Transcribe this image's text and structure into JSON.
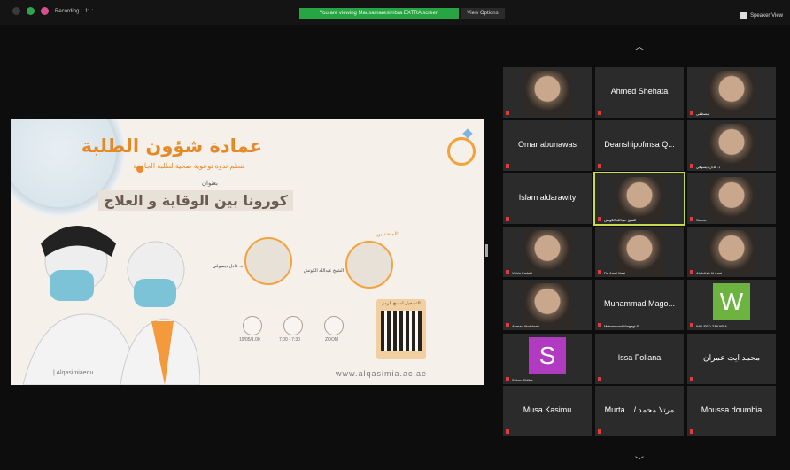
{
  "topbar": {
    "meeting_title": "Recording... 11 :",
    "share_banner": "You are viewing Mausamaresimbra EXTRA screen",
    "view_options": "View Options",
    "speaker_view": "Speaker View"
  },
  "slide": {
    "title_ar": "عمادة شؤون الطلبة",
    "subtitle_ar": "تنظم ندوة توعوية صحية لطلبة الجامعة",
    "by_title_ar": "بعنوان",
    "topic_ar": "كورونا بين الوقاية و العلاج",
    "speakers_label_ar": "المتحدثين:",
    "speaker1_name_ar": "د. عادل ديسوقي",
    "speaker2_name_ar": "الشيخ عبدالله الكوتش",
    "icon_label_1": "19/05/1.00",
    "icon_label_2": "7:00 - 7:30",
    "icon_label_3": "ZOOM",
    "qr_label": "للتسجيل امسح الرمز",
    "footer_left": "| Alqasimiaedu",
    "footer_right": "www.alqasimia.ac.ae"
  },
  "participants": [
    {
      "name": "",
      "tag": "",
      "kind": "video"
    },
    {
      "name": "Ahmed Shehata",
      "tag": "",
      "kind": "text"
    },
    {
      "name": "",
      "tag": "مصطفى",
      "kind": "video"
    },
    {
      "name": "Omar abunawas",
      "tag": "",
      "kind": "text"
    },
    {
      "name": "Deanshipofmsa Q...",
      "tag": "",
      "kind": "text"
    },
    {
      "name": "",
      "tag": "د. عادل ديسوقي",
      "kind": "video"
    },
    {
      "name": "Islam aldarawity",
      "tag": "",
      "kind": "text"
    },
    {
      "name": "",
      "tag": "الشيخ عبدالله الكوتش",
      "kind": "video"
    },
    {
      "name": "",
      "tag": "Salma",
      "kind": "video"
    },
    {
      "name": "",
      "tag": "Yahia Sadeki",
      "kind": "video"
    },
    {
      "name": "",
      "tag": "Dr. Amel Nezi",
      "kind": "video"
    },
    {
      "name": "",
      "tag": "Abdullah Al Amri",
      "kind": "video"
    },
    {
      "name": "",
      "tag": "Ahmad Abdelaziz",
      "kind": "video"
    },
    {
      "name": "Muhammad Mago...",
      "tag": "Muhammad Magagi S...",
      "kind": "text"
    },
    {
      "name": "W",
      "tag": "WALEED ZAKARIA",
      "kind": "avatar",
      "color": "#6cb33f"
    },
    {
      "name": "S",
      "tag": "Sekou Sidibe",
      "kind": "avatar",
      "color": "#b03ac0"
    },
    {
      "name": "Issa Follana",
      "tag": "",
      "kind": "text"
    },
    {
      "name": "محمد ايت عمران",
      "tag": "",
      "kind": "text"
    },
    {
      "name": "Musa Kasimu",
      "tag": "",
      "kind": "text"
    },
    {
      "name": "Murta... / مرتلا محمد",
      "tag": "",
      "kind": "text"
    },
    {
      "name": "Moussa doumbia",
      "tag": "",
      "kind": "text"
    }
  ]
}
